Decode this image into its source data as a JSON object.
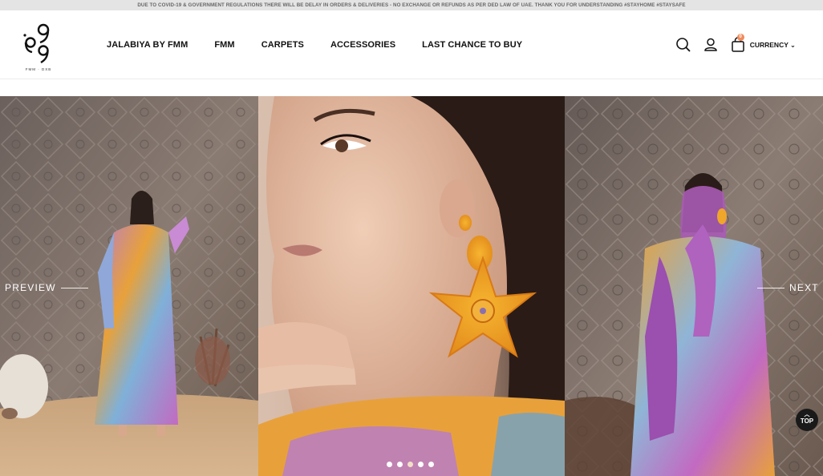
{
  "announcement": "DUE TO COVID-19 & GOVERNMENT REGULATIONS THERE WILL BE DELAY IN ORDERS & DELIVERIES - NO EXCHANGE OR REFUNDS AS PER DED LAW OF UAE. THANK YOU FOR UNDERSTANDING #STAYHOME #STAYSAFE",
  "logo": {
    "tagline": "FMM · DXB"
  },
  "nav": [
    {
      "label": "JALABIYA BY FMM"
    },
    {
      "label": "FMM"
    },
    {
      "label": "CARPETS"
    },
    {
      "label": "ACCESSORIES"
    },
    {
      "label": "LAST CHANCE TO BUY"
    }
  ],
  "header": {
    "icons": [
      "search-icon",
      "user-icon",
      "shopping-bag-icon"
    ],
    "cart_count": "0",
    "currency_label": "CURRENCY",
    "currency_chevron": "⌄"
  },
  "slider": {
    "prev_label": "PREVIEW",
    "next_label": "NEXT",
    "dots_count": 5,
    "active_dot": 2,
    "slides": [
      "woman in printed jalabiya standing before carpet wall",
      "close-up of woman wearing orange beaded star earring",
      "woman in printed jalabiya with purple scarf"
    ]
  },
  "top_button": {
    "label": "TOP",
    "chevron": "︿"
  },
  "colors": {
    "accent": "#f08a5b",
    "topbar_bg": "#e4e4e4",
    "dark": "#1a1a1a"
  }
}
